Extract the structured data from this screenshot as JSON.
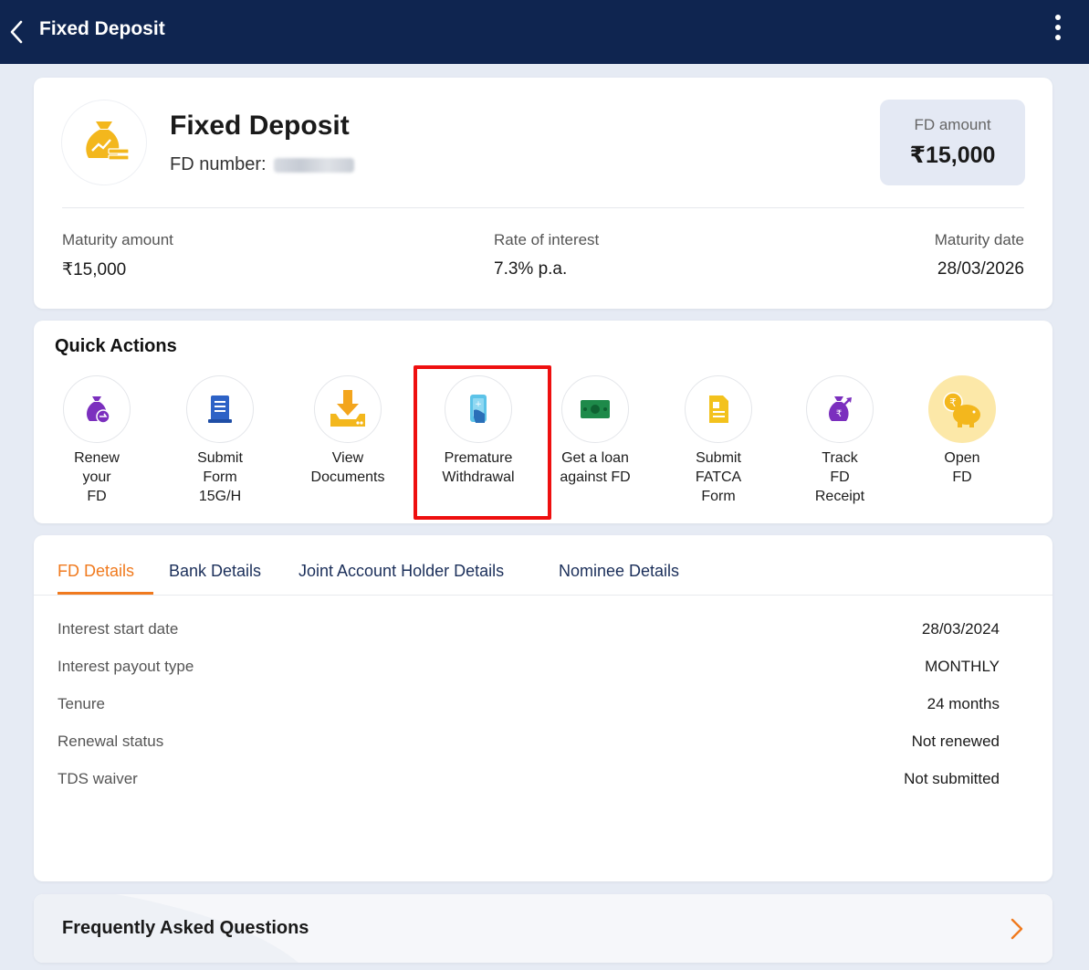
{
  "header": {
    "title": "Fixed Deposit"
  },
  "summary": {
    "title": "Fixed Deposit",
    "fd_number_label": "FD number:",
    "fd_amount_label": "FD amount",
    "fd_amount_value": "₹15,000",
    "stats": [
      {
        "label": "Maturity amount",
        "value": "₹15,000"
      },
      {
        "label": "Rate of interest",
        "value": "7.3% p.a."
      },
      {
        "label": "Maturity date",
        "value": "28/03/2026"
      }
    ]
  },
  "quick_actions": {
    "title": "Quick Actions",
    "items": [
      {
        "label": "Renew\nyour\nFD",
        "icon": "renew-fd-icon"
      },
      {
        "label": "Submit\nForm\n15G/H",
        "icon": "submit-form-icon"
      },
      {
        "label": "View\nDocuments",
        "icon": "download-documents-icon"
      },
      {
        "label": "Premature\nWithdrawal",
        "icon": "premature-withdrawal-icon"
      },
      {
        "label": "Get a loan\nagainst FD",
        "icon": "cash-loan-icon"
      },
      {
        "label": "Submit\nFATCA\nForm",
        "icon": "fatca-form-icon"
      },
      {
        "label": "Track\nFD\nReceipt",
        "icon": "track-receipt-icon"
      },
      {
        "label": "Open\nFD",
        "icon": "piggy-bank-icon"
      }
    ],
    "highlight_color": "#ee0f0f"
  },
  "details": {
    "tabs": [
      "FD Details",
      "Bank Details",
      "Joint Account Holder Details",
      "Nominee Details"
    ],
    "active_tab": "FD Details",
    "rows": [
      {
        "key": "Interest start date",
        "value": "28/03/2024"
      },
      {
        "key": "Interest payout type",
        "value": "MONTHLY"
      },
      {
        "key": "Tenure",
        "value": "24 months"
      },
      {
        "key": "Renewal status",
        "value": "Not renewed"
      },
      {
        "key": "TDS waiver",
        "value": "Not submitted"
      }
    ]
  },
  "faq": {
    "title": "Frequently Asked Questions"
  },
  "colors": {
    "header_bg": "#0f2550",
    "accent_orange": "#f07a1e",
    "tab_text": "#1b2f5a",
    "icon_purple": "#7b2fbe",
    "icon_gold": "#f3b71d"
  }
}
